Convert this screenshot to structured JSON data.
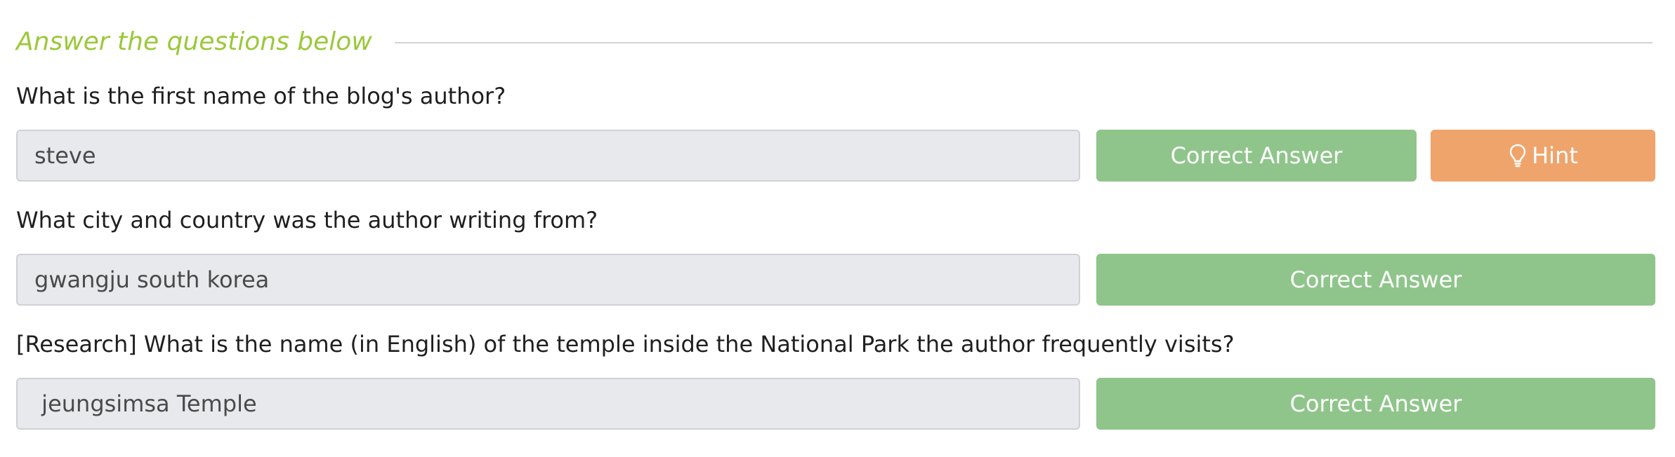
{
  "section": {
    "title": "Answer the questions below"
  },
  "questions": [
    {
      "text": "What is the first name of the blog's author?",
      "answer": "steve",
      "status_label": "Correct Answer",
      "hint_label": "Hint"
    },
    {
      "text": "What city and country was the author writing from?",
      "answer": "gwangju south korea",
      "status_label": "Correct Answer"
    },
    {
      "text": "[Research] What is the name (in English) of the temple inside the National Park the author frequently visits?",
      "answer": " jeungsimsa Temple",
      "status_label": "Correct Answer"
    }
  ],
  "icons": {
    "hint": "lightbulb-icon"
  },
  "colors": {
    "section_title": "#9bc83a",
    "correct_button": "#8fc58b",
    "hint_button": "#efa46c",
    "field_background": "#e8e9ed"
  }
}
